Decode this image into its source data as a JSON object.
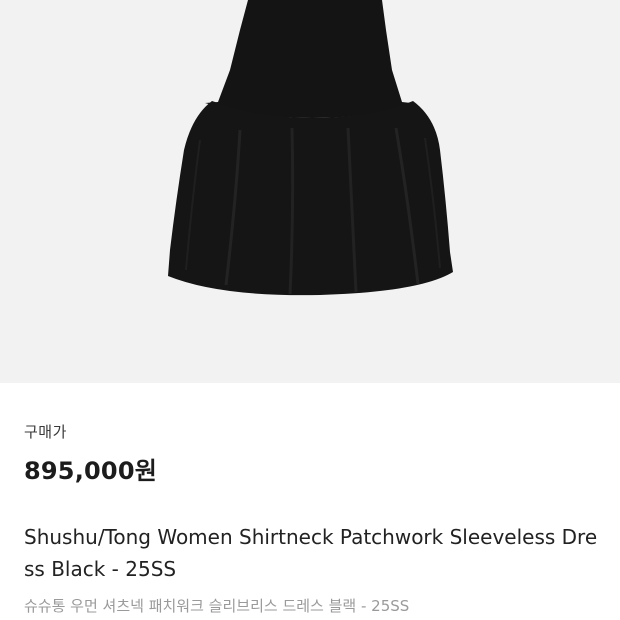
{
  "product": {
    "image_alt": "black sleeveless drop-waist dress",
    "price_label": "구매가",
    "price": "895,000원",
    "title": "Shushu/Tong Women Shirtneck Patchwork Sleeveless Dress Black - 25SS",
    "subtitle": "슈슈통 우먼 셔츠넥 패치워크 슬리브리스 드레스 블랙 - 25SS"
  },
  "colors": {
    "image_background": "#f3f2f2",
    "dress": "#141414",
    "price_text": "#1c1c1c",
    "subtitle_text": "#9a9a9a"
  }
}
